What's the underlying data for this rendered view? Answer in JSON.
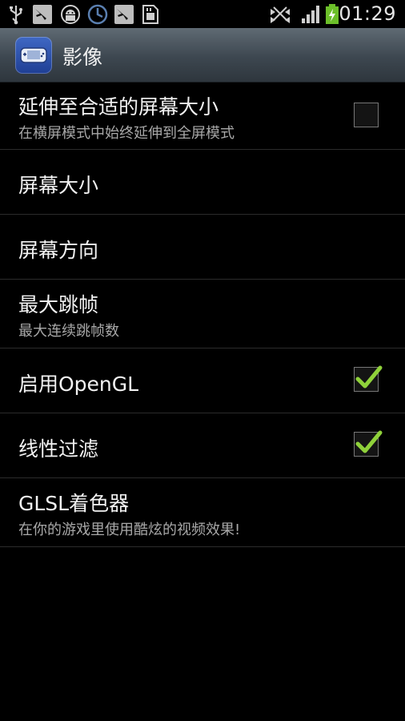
{
  "status_bar": {
    "time": "01:29",
    "left_icons": [
      "usb-icon",
      "airplane-mode-icon",
      "android-debug-icon",
      "sync-icon",
      "airplane-mode-icon",
      "sd-card-icon"
    ],
    "right_icons": [
      "signal-blocked-icon",
      "cell-signal-icon",
      "battery-charging-icon"
    ]
  },
  "action_bar": {
    "title": "影像",
    "icon": "gba-emulator-app-icon"
  },
  "settings": {
    "items": [
      {
        "title": "延伸至合适的屏幕大小",
        "summary": "在横屏模式中始终延伸到全屏模式",
        "checkbox": true,
        "checked": false
      },
      {
        "title": "屏幕大小",
        "summary": "",
        "checkbox": false,
        "checked": false
      },
      {
        "title": "屏幕方向",
        "summary": "",
        "checkbox": false,
        "checked": false
      },
      {
        "title": "最大跳帧",
        "summary": "最大连续跳帧数",
        "checkbox": false,
        "checked": false
      },
      {
        "title": "启用OpenGL",
        "summary": "",
        "checkbox": true,
        "checked": true
      },
      {
        "title": "线性过滤",
        "summary": "",
        "checkbox": true,
        "checked": true
      },
      {
        "title": "GLSL着色器",
        "summary": "在你的游戏里使用酷炫的视频效果!",
        "checkbox": false,
        "checked": false
      }
    ]
  },
  "colors": {
    "check_mark": "#8fd13a",
    "background": "#000000",
    "action_bar": "#3d4750"
  }
}
